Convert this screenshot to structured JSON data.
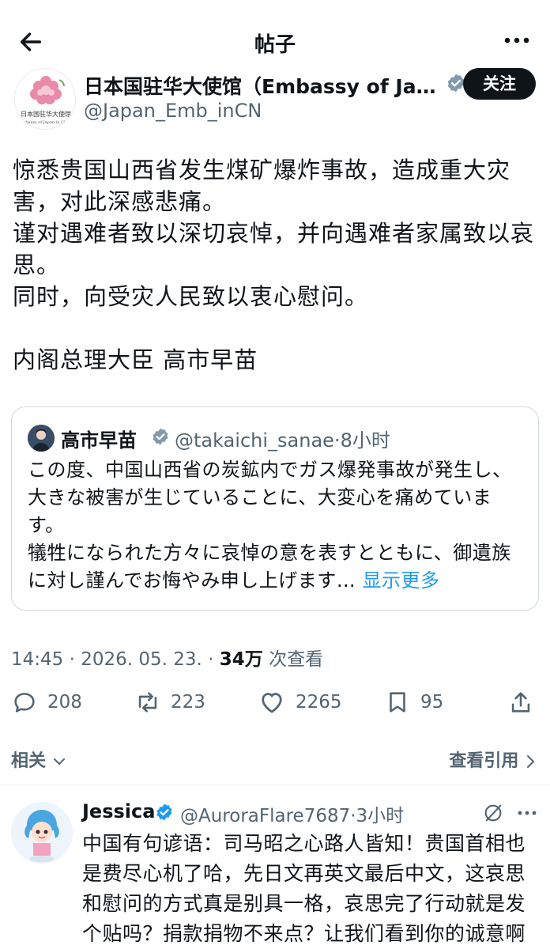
{
  "header": {
    "title": "帖子"
  },
  "author": {
    "name": "日本国驻华大使馆（Embassy of Japan in China）",
    "handle": "@Japan_Emb_inCN",
    "follow_label": "关注",
    "avatar_caption_cn": "日本国驻华大使馆",
    "avatar_caption_en": "Embassy of Japan in China"
  },
  "post": {
    "body": "惊悉贵国山西省发生煤矿爆炸事故，造成重大灾害，对此深感悲痛。\n谨对遇难者致以深切哀悼，并向遇难者家属致以哀思。\n同时，向受灾人民致以衷心慰问。\n\n内阁总理大臣 高市早苗"
  },
  "quote": {
    "name": "高市早苗",
    "handle": "@takaichi_sanae",
    "time": "8小时",
    "text": "この度、中国山西省の炭鉱内でガス爆発事故が発生し、大きな被害が生じていることに、大変心を痛めています。\n犠牲になられた方々に哀悼の意を表すとともに、御遺族に対し謹んでお悔やみ申し上げます…",
    "show_more": "显示更多"
  },
  "meta": {
    "time": "14:45",
    "date": "2026. 05. 23.",
    "views": "34万",
    "views_label": "次查看"
  },
  "stats": {
    "replies": "208",
    "retweets": "223",
    "likes": "2265",
    "bookmarks": "95"
  },
  "links": {
    "related": "相关",
    "quotes": "查看引用"
  },
  "reply": {
    "name": "Jessica",
    "handle": "@AuroraFlare7687",
    "time": "3小时",
    "text": "中国有句谚语：司马昭之心路人皆知！贵国首相也是费尽心机了哈，先日文再英文最后中文，这哀思和慰问的方式真是别具一格，哀思完了行动就是发个贴吗？捐款捐物不来点？让我们看到你的诚意啊"
  },
  "colors": {
    "accent": "#1d9bf0",
    "text": "#0f1419",
    "muted": "#536471",
    "border": "#cfd9de"
  }
}
